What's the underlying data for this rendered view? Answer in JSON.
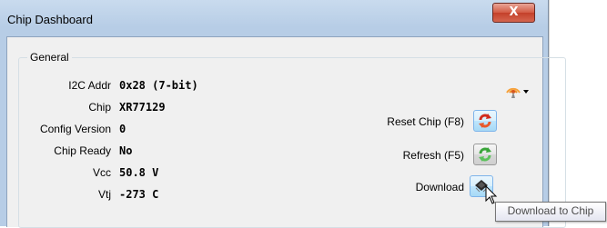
{
  "window": {
    "title": "Chip Dashboard",
    "close_label": "X"
  },
  "group": {
    "label": "General"
  },
  "fields": [
    {
      "key": "I2C Addr",
      "value": "0x28 (7-bit)"
    },
    {
      "key": "Chip",
      "value": "XR77129"
    },
    {
      "key": "Config Version",
      "value": "0"
    },
    {
      "key": "Chip Ready",
      "value": "No"
    },
    {
      "key": "Vcc",
      "value": "50.8 V"
    },
    {
      "key": "Vtj",
      "value": "-273 C"
    }
  ],
  "actions": {
    "reset_label": "Reset Chip (F8)",
    "refresh_label": "Refresh (F5)",
    "download_label": "Download"
  },
  "tooltip": "Download to Chip",
  "icons": {
    "antenna": "antenna-dropdown-icon",
    "reset": "red-refresh-icon",
    "refresh": "green-refresh-icon",
    "download": "chip-icon"
  }
}
